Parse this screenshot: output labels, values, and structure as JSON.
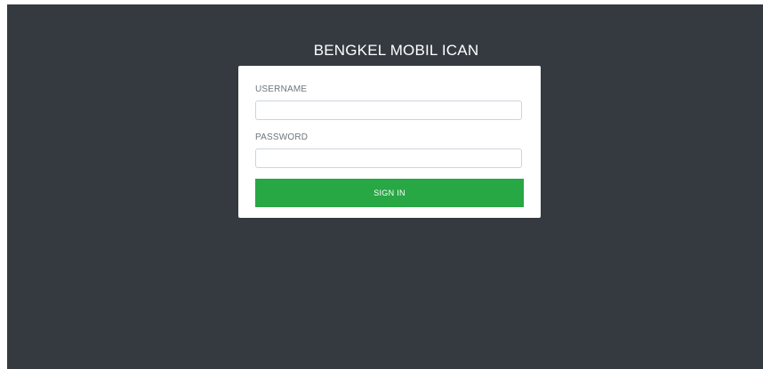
{
  "header": {
    "title": "BENGKEL MOBIL ICAN"
  },
  "login_form": {
    "username_label": "USERNAME",
    "username_value": "",
    "username_placeholder": "",
    "password_label": "PASSWORD",
    "password_value": "",
    "password_placeholder": "",
    "submit_label": "SIGN IN"
  },
  "colors": {
    "background": "#343a40",
    "card": "#ffffff",
    "button": "#28a745",
    "label": "#6c757d"
  }
}
